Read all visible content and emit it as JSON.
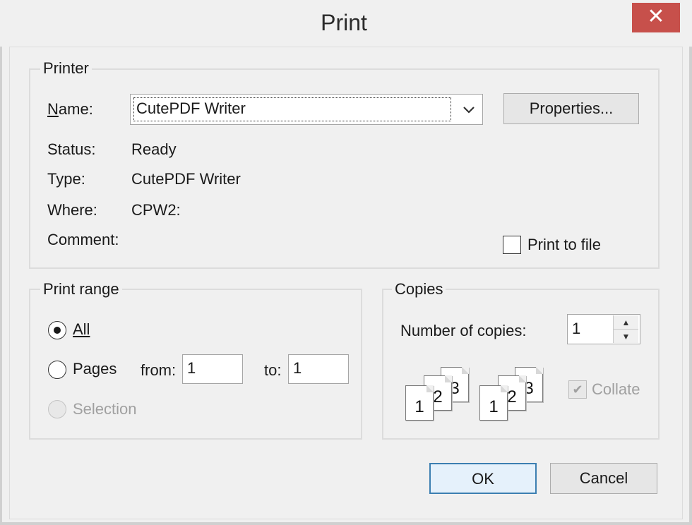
{
  "window": {
    "title": "Print",
    "close_label": "✕"
  },
  "printer": {
    "legend": "Printer",
    "name_label": "Name:",
    "name_value": "CutePDF Writer",
    "properties_label": "Properties...",
    "status_label": "Status:",
    "status_value": "Ready",
    "type_label": "Type:",
    "type_value": "CutePDF Writer",
    "where_label": "Where:",
    "where_value": "CPW2:",
    "comment_label": "Comment:",
    "print_to_file_label": "Print to file",
    "print_to_file_checked": false
  },
  "print_range": {
    "legend": "Print range",
    "all_label": "All",
    "pages_label": "Pages",
    "from_label": "from:",
    "from_value": "1",
    "to_label": "to:",
    "to_value": "1",
    "selection_label": "Selection",
    "selected": "All"
  },
  "copies": {
    "legend": "Copies",
    "number_label": "Number of copies:",
    "number_value": "1",
    "collate_label": "Collate",
    "collate_checked": true,
    "collate_icon_pages": [
      "1",
      "2",
      "3"
    ]
  },
  "buttons": {
    "ok_label": "OK",
    "cancel_label": "Cancel"
  },
  "colors": {
    "close_button": "#c7504b",
    "default_button_border": "#3c7fb1"
  },
  "icons": {
    "close": "close-icon",
    "dropdown": "chevron-down-icon",
    "spin_up": "arrow-up-icon",
    "spin_down": "arrow-down-icon",
    "check": "checkmark-icon"
  }
}
